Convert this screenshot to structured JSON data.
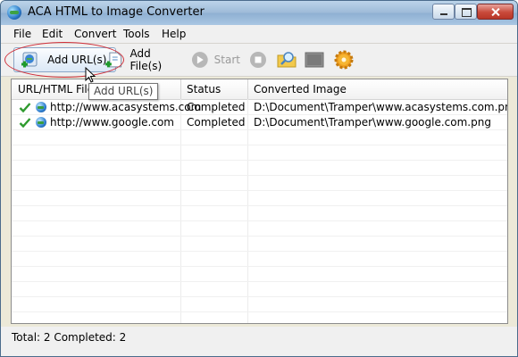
{
  "window": {
    "title": "ACA HTML to Image Converter"
  },
  "menu": {
    "items": [
      "File",
      "Edit",
      "Convert",
      "Tools",
      "Help"
    ]
  },
  "toolbar": {
    "add_url_label": "Add URL(s)",
    "add_file_label": "Add File(s)",
    "start_label": "Start",
    "icons": [
      "add-url-icon",
      "add-file-icon",
      "start-icon",
      "stop-icon",
      "folder-search-icon",
      "window-icon",
      "settings-gear-icon"
    ]
  },
  "tooltip": {
    "text": "Add URL(s)"
  },
  "list": {
    "columns": [
      "URL/HTML File",
      "Status",
      "Converted Image"
    ],
    "rows": [
      {
        "url": "http://www.acasystems.com",
        "status": "Completed",
        "image": "D:\\Document\\Tramper\\www.acasystems.com.png"
      },
      {
        "url": "http://www.google.com",
        "status": "Completed",
        "image": "D:\\Document\\Tramper\\www.google.com.png"
      }
    ]
  },
  "status": {
    "text": "Total: 2  Completed: 2"
  },
  "colors": {
    "highlight_ellipse": "#d0303a",
    "check_green": "#2e9a2e"
  }
}
